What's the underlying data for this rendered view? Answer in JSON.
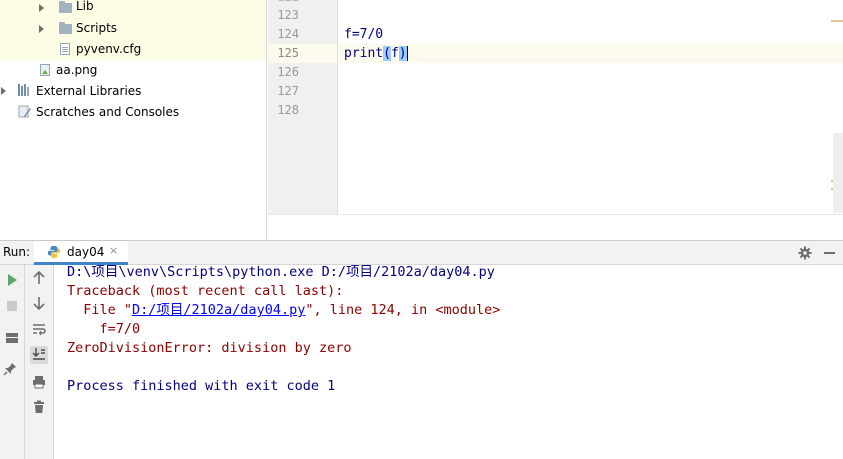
{
  "project_tree": {
    "items": [
      {
        "label": "Lib",
        "type": "folder"
      },
      {
        "label": "Scripts",
        "type": "folder"
      },
      {
        "label": "pyvenv.cfg",
        "type": "file"
      },
      {
        "label": "aa.png",
        "type": "image"
      },
      {
        "label": "External Libraries",
        "type": "library"
      },
      {
        "label": "Scratches and Consoles",
        "type": "scratch"
      }
    ]
  },
  "editor": {
    "line_numbers": [
      "123",
      "124",
      "125",
      "126",
      "127",
      "128"
    ],
    "current_line": "125",
    "code": {
      "line_124": "f=7/0",
      "line_125_fn": "print",
      "line_125_open": "(",
      "line_125_arg": "f",
      "line_125_close": ")"
    }
  },
  "run_panel": {
    "label": "Run:",
    "tab": {
      "label": "day04",
      "close": "×"
    },
    "toolbar_icons": [
      "run-icon",
      "stop-icon",
      "layout-icon",
      "pin-icon",
      "scroll-up-icon",
      "scroll-down-icon",
      "soft-wrap-icon",
      "scroll-to-end-icon",
      "print-icon",
      "trash-icon"
    ]
  },
  "console": {
    "command": "D:\\项目\\venv\\Scripts\\python.exe D:/项目/2102a/day04.py",
    "traceback_header": "Traceback (most recent call last):",
    "file_prefix": "  File \"",
    "file_link": "D:/项目/2102a/day04.py",
    "file_suffix": "\", line 124, in <module>",
    "code_echo": "    f=7/0",
    "error": "ZeroDivisionError: division by zero",
    "exit": "Process finished with exit code 1"
  },
  "colors": {
    "accent": "#4083c9",
    "run_green": "#59a869",
    "error_text": "#8b0000",
    "link": "#0000ff",
    "console_text": "#000080",
    "current_line": "#fcfaed",
    "tree_highlight": "#fdfde6"
  }
}
